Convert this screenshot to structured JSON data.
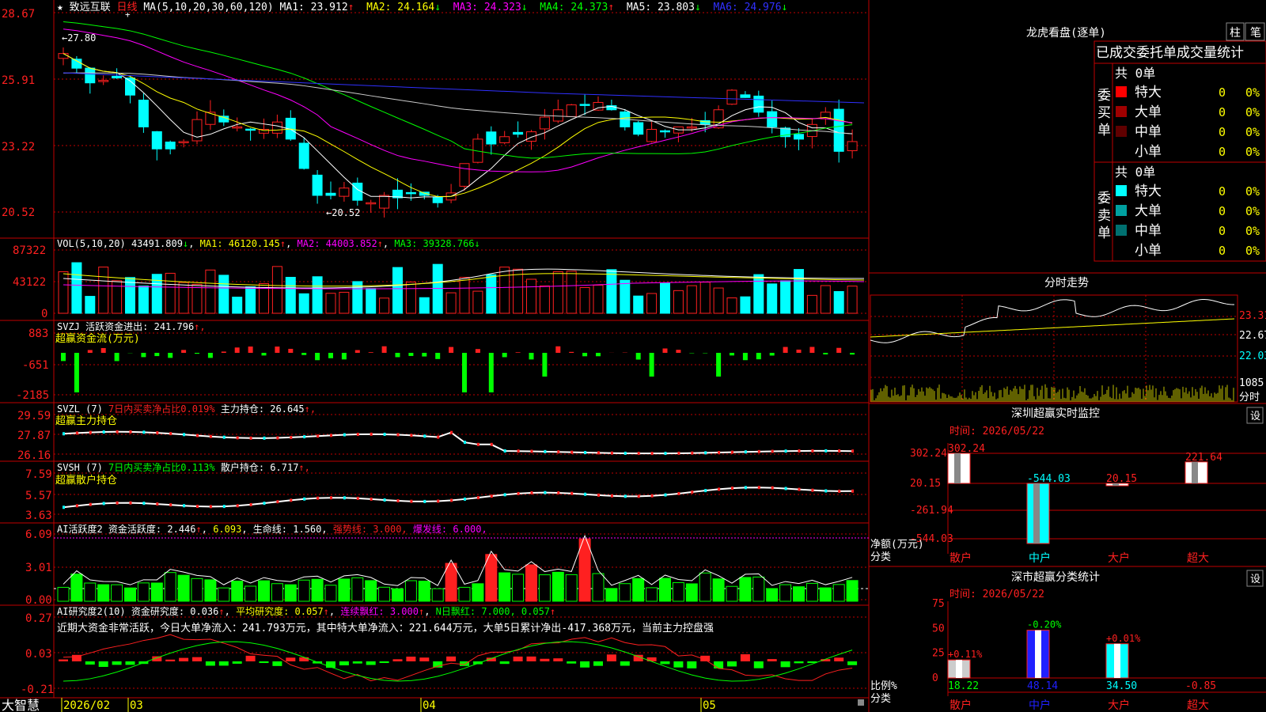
{
  "colors": {
    "up": "#ff2020",
    "down": "#00ffff",
    "grid": "#c00000",
    "yellow": "#ffff00",
    "white": "#ffffff",
    "green": "#00ff00",
    "magenta": "#ff00ff",
    "blue": "#3030ff"
  },
  "price": {
    "title_star": "★",
    "title": "致远互联",
    "period": "日线",
    "ma_params": "MA(5,10,20,30,60,120)",
    "ma": [
      {
        "label": "MA1: 23.912",
        "arrow": "↑",
        "color": "#ffffff"
      },
      {
        "label": "MA2: 24.164",
        "arrow": "↓",
        "color": "#ffff00"
      },
      {
        "label": "MA3: 24.323",
        "arrow": "↓",
        "color": "#ff00ff"
      },
      {
        "label": "MA4: 24.373",
        "arrow": "↑",
        "color": "#00ff00"
      },
      {
        "label": "MA5: 23.803",
        "arrow": "↓",
        "color": "#ffffff"
      },
      {
        "label": "MA6: 24.976",
        "arrow": "↓",
        "color": "#3030ff"
      }
    ],
    "yticks": [
      "28.67",
      "25.91",
      "23.22",
      "20.52"
    ],
    "high_mark": "27.80",
    "low_mark": "20.52"
  },
  "vol": {
    "params": "VOL(5,10,20)",
    "value": "43491.809",
    "value_arrow": "↓",
    "ma1": "MA1: 46120.145",
    "ma1_arrow": "↑",
    "ma2": "MA2: 44003.852",
    "ma2_arrow": "↑",
    "ma3": "MA3: 39328.766",
    "ma3_arrow": "↓",
    "yticks": [
      "87322",
      "43122",
      "0"
    ]
  },
  "svzj": {
    "name": "SVZJ",
    "label": "活跃资金进出: 241.796",
    "arrow": "↑,",
    "sub": "超赢资金流(万元)",
    "yticks": [
      "883",
      "-651",
      "-2185"
    ]
  },
  "svzl": {
    "name": "SVZL (7)",
    "label1": "7日内买卖净占比0.019%",
    "label2": "主力持仓: 26.645",
    "arrow": "↑,",
    "sub": "超赢主力持仓",
    "yticks": [
      "29.59",
      "27.87",
      "26.16"
    ]
  },
  "svsh": {
    "name": "SVSH (7)",
    "label1": "7日内买卖净占比0.113%",
    "label2": "散户持仓: 6.717",
    "arrow": "↑,",
    "sub": "超赢散户持仓",
    "yticks": [
      "7.59",
      "5.57",
      "3.63"
    ]
  },
  "ai1": {
    "name": "AI活跃度2",
    "label": "资金活跃度: 2.446",
    "a1": "↑",
    "v2": "6.093",
    "a2": ",",
    "life": "生命线: 1.560,",
    "strong": "强势线: 3.000,",
    "burst": "爆发线: 6.000,",
    "yticks": [
      "6.09",
      "3.01",
      "0.00"
    ]
  },
  "ai2": {
    "name": "AI研究度2(10)",
    "label": "资金研究度: 0.036",
    "a1": "↑",
    "avg": "平均研究度: 0.057",
    "a2": "↑",
    "cont": "连续飘红: 3.000",
    "a3": "↑",
    "nday": "N日飘红: 7.000, 0.057",
    "a4": "↑",
    "comment": "近期大资金非常活跃，今日大单净流入：241.793万元，其中特大单净流入：221.644万元，大单5日累计净出-417.368万元，当前主力控盘强",
    "yticks": [
      "0.27",
      "0.03",
      "-0.21"
    ]
  },
  "bottom_axis": {
    "brand": "大智慧",
    "labels": [
      "2026/02",
      "03",
      "04",
      "05"
    ]
  },
  "lhb": {
    "title": "龙虎看盘(逐单)",
    "btn1": "柱",
    "btn2": "笔",
    "header": "已成交委托单成交量统计",
    "buy_label": "委买单",
    "sell_label": "委卖单",
    "buy_total": "共 0单",
    "sell_total": "共 0单",
    "rows_buy": [
      {
        "name": "特大",
        "count": "0",
        "pct": "0%",
        "color": "#ff0000"
      },
      {
        "name": "大单",
        "count": "0",
        "pct": "0%",
        "color": "#a00000"
      },
      {
        "name": "中单",
        "count": "0",
        "pct": "0%",
        "color": "#600000"
      },
      {
        "name": "小单",
        "count": "0",
        "pct": "0%",
        "color": ""
      }
    ],
    "rows_sell": [
      {
        "name": "特大",
        "count": "0",
        "pct": "0%",
        "color": "#00ffff"
      },
      {
        "name": "大单",
        "count": "0",
        "pct": "0%",
        "color": "#00a0a0"
      },
      {
        "name": "中单",
        "count": "0",
        "pct": "0%",
        "color": "#007070"
      },
      {
        "name": "小单",
        "count": "0",
        "pct": "0%",
        "color": ""
      }
    ]
  },
  "fs": {
    "title": "分时走势",
    "yticks": [
      "23.31",
      "22.67",
      "22.03"
    ],
    "vol_top": "1085",
    "vol_label": "分时"
  },
  "sz_monitor": {
    "title": "深圳超赢实时监控",
    "btn": "设",
    "time": "时间: 2026/05/22",
    "yticks": [
      "302.24",
      "20.15",
      "-261.94",
      "-544.03"
    ],
    "ylabel1": "净额(万元)",
    "ylabel2": "分类",
    "cats": [
      "散户",
      "中户",
      "大户",
      "超大"
    ],
    "values": [
      302.24,
      -544.03,
      20.15,
      221.64
    ],
    "value_labels": [
      "302.24",
      "-544.03",
      "20.15",
      "221.64"
    ]
  },
  "sz_class": {
    "title": "深市超赢分类统计",
    "btn": "设",
    "time": "时间: 2026/05/22",
    "yticks": [
      "75",
      "50",
      "25",
      "0"
    ],
    "ylabel1": "比例%",
    "ylabel2": "分类",
    "cats": [
      "散户",
      "中户",
      "大户",
      "超大"
    ],
    "values": [
      18.22,
      48.14,
      34.5,
      -0.85
    ],
    "value_labels": [
      "18.22",
      "48.14",
      "34.50",
      "-0.85"
    ],
    "changes": [
      "+0.11%",
      "-0.20%",
      "+0.01%",
      ""
    ]
  },
  "chart_data": {
    "type": "bar",
    "categories": [
      "散户",
      "中户",
      "大户",
      "超大"
    ],
    "series": [
      {
        "name": "净额(万元)",
        "values": [
          302.24,
          -544.03,
          20.15,
          221.64
        ]
      }
    ],
    "title": "深圳超赢实时监控"
  }
}
